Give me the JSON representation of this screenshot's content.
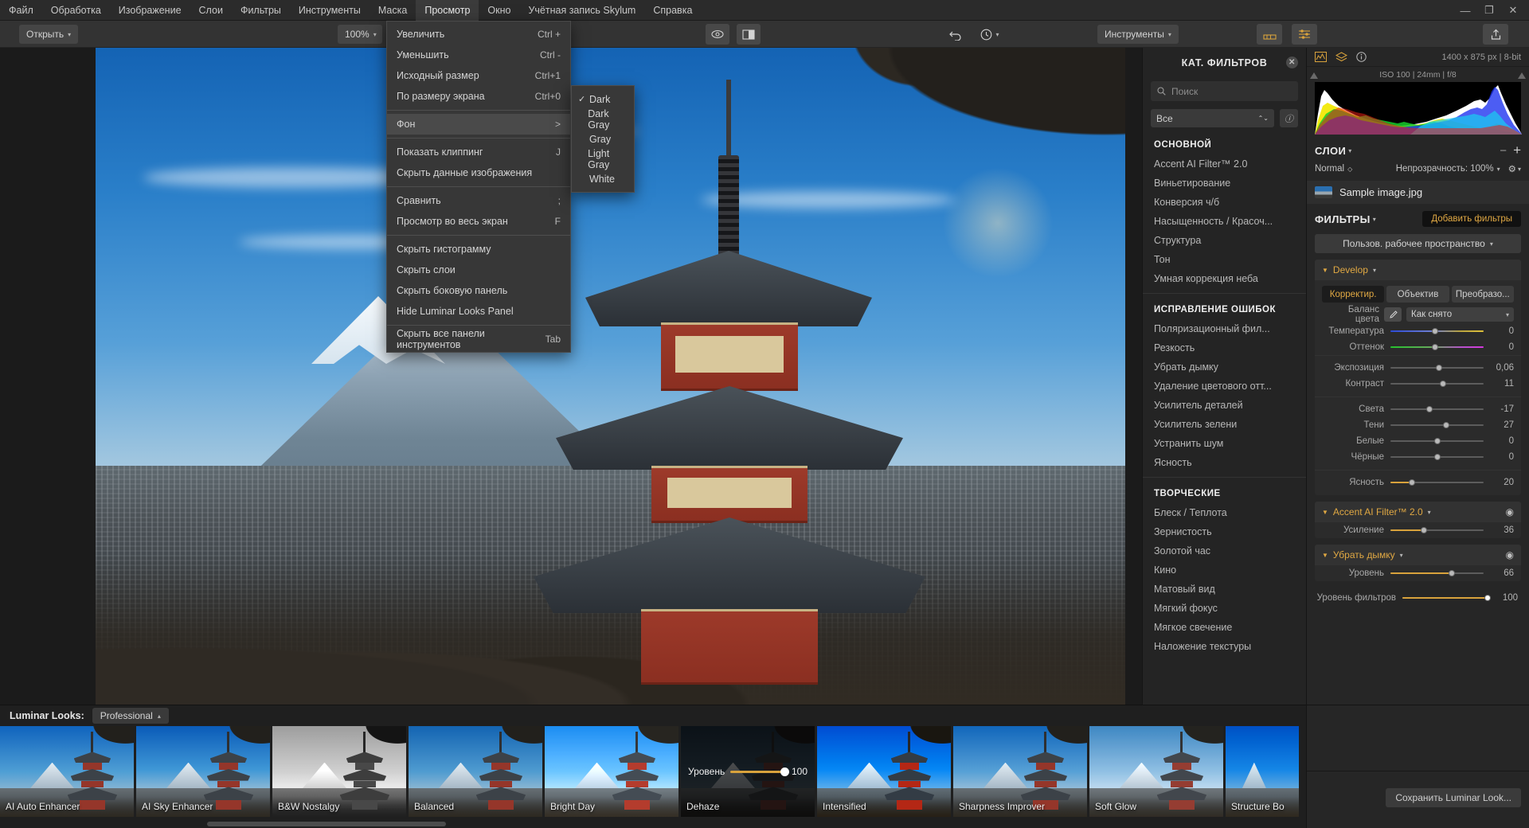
{
  "app": {
    "menubar": [
      {
        "label": "Файл",
        "active": false
      },
      {
        "label": "Обработка",
        "active": false
      },
      {
        "label": "Изображение",
        "active": false
      },
      {
        "label": "Слои",
        "active": false
      },
      {
        "label": "Фильтры",
        "active": false
      },
      {
        "label": "Инструменты",
        "active": false
      },
      {
        "label": "Маска",
        "active": false
      },
      {
        "label": "Просмотр",
        "active": true
      },
      {
        "label": "Окно",
        "active": false
      },
      {
        "label": "Учётная запись Skylum",
        "active": false
      },
      {
        "label": "Справка",
        "active": false
      }
    ],
    "window_controls": {
      "minimize": "—",
      "maximize": "❐",
      "close": "✕"
    }
  },
  "toolbar": {
    "open_label": "Открыть",
    "zoom_value": "100%",
    "tools_label": "Инструменты"
  },
  "view_menu": {
    "items": [
      {
        "label": "Увеличить",
        "shortcut": "Ctrl +",
        "sep_after": false,
        "highlight": false,
        "submenu": false
      },
      {
        "label": "Уменьшить",
        "shortcut": "Ctrl -",
        "sep_after": false,
        "highlight": false,
        "submenu": false
      },
      {
        "label": "Исходный размер",
        "shortcut": "Ctrl+1",
        "sep_after": false,
        "highlight": false,
        "submenu": false
      },
      {
        "label": "По размеру экрана",
        "shortcut": "Ctrl+0",
        "sep_after": true,
        "highlight": false,
        "submenu": false
      },
      {
        "label": "Фон",
        "shortcut": ">",
        "sep_after": true,
        "highlight": true,
        "submenu": true
      },
      {
        "label": "Показать клиппинг",
        "shortcut": "J",
        "sep_after": false,
        "highlight": false,
        "submenu": false
      },
      {
        "label": "Скрыть данные изображения",
        "shortcut": "",
        "sep_after": true,
        "highlight": false,
        "submenu": false
      },
      {
        "label": "Сравнить",
        "shortcut": ";",
        "sep_after": false,
        "highlight": false,
        "submenu": false
      },
      {
        "label": "Просмотр во весь экран",
        "shortcut": "F",
        "sep_after": true,
        "highlight": false,
        "submenu": false
      },
      {
        "label": "Скрыть гистограмму",
        "shortcut": "",
        "sep_after": false,
        "highlight": false,
        "submenu": false
      },
      {
        "label": "Скрыть слои",
        "shortcut": "",
        "sep_after": false,
        "highlight": false,
        "submenu": false
      },
      {
        "label": "Скрыть боковую панель",
        "shortcut": "",
        "sep_after": false,
        "highlight": false,
        "submenu": false
      },
      {
        "label": "Hide Luminar Looks Panel",
        "shortcut": "",
        "sep_after": true,
        "highlight": false,
        "submenu": false
      },
      {
        "label": "Скрыть все панели инструментов",
        "shortcut": "Tab",
        "sep_after": false,
        "highlight": false,
        "submenu": false
      }
    ],
    "submenu": {
      "title": "Фон",
      "items": [
        {
          "label": "Dark",
          "checked": true
        },
        {
          "label": "Dark Gray",
          "checked": false
        },
        {
          "label": "Gray",
          "checked": false
        },
        {
          "label": "Light Gray",
          "checked": false
        },
        {
          "label": "White",
          "checked": false
        }
      ]
    }
  },
  "catalog": {
    "title": "КАТ. ФИЛЬТРОВ",
    "search_placeholder": "Поиск",
    "filter_select": "Все",
    "groups": [
      {
        "name": "ОСНОВНОЙ",
        "items": [
          "Accent AI Filter™ 2.0",
          "Виньетирование",
          "Конверсия ч/б",
          "Насыщенность / Красоч...",
          "Структура",
          "Тон",
          "Умная коррекция неба"
        ]
      },
      {
        "name": "ИСПРАВЛЕНИЕ ОШИБОК",
        "items": [
          "Поляризационный фил...",
          "Резкость",
          "Убрать дымку",
          "Удаление цветового отт...",
          "Усилитель деталей",
          "Усилитель зелени",
          "Устранить шум",
          "Ясность"
        ]
      },
      {
        "name": "ТВОРЧЕСКИЕ",
        "items": [
          "Блеск / Теплота",
          "Зернистость",
          "Золотой час",
          "Кино",
          "Матовый вид",
          "Мягкий фокус",
          "Мягкое свечение",
          "Наложение текстуры"
        ]
      }
    ]
  },
  "right_panel": {
    "image_info": "1400 x 875 px  |  8-bit",
    "exif": "ISO 100  |  24mm  |  f/8",
    "layers_title": "СЛОИ",
    "blend_mode": "Normal",
    "opacity_label": "Непрозрачность: 100%",
    "layer_name": "Sample image.jpg",
    "filters_title": "ФИЛЬТРЫ",
    "add_filters_label": "Добавить фильтры",
    "workspace_label": "Пользов. рабочее пространство",
    "develop_label": "Develop",
    "tabs": [
      {
        "label": "Корректир.",
        "active": true
      },
      {
        "label": "Объектив",
        "active": false
      },
      {
        "label": "Преобразо...",
        "active": false
      }
    ],
    "white_balance": {
      "label": "Баланс цвета",
      "value": "Как снято"
    },
    "sliders": [
      {
        "label": "Температура",
        "value": "0",
        "pos": 48,
        "type": "temp"
      },
      {
        "label": "Оттенок",
        "value": "0",
        "pos": 48,
        "type": "tint"
      }
    ],
    "sliders2": [
      {
        "label": "Экспозиция",
        "value": "0,06",
        "pos": 52
      },
      {
        "label": "Контраст",
        "value": "11",
        "pos": 56
      }
    ],
    "sliders3": [
      {
        "label": "Света",
        "value": "-17",
        "pos": 42
      },
      {
        "label": "Тени",
        "value": "27",
        "pos": 60
      },
      {
        "label": "Белые",
        "value": "0",
        "pos": 50
      },
      {
        "label": "Чёрные",
        "value": "0",
        "pos": 50
      }
    ],
    "sliders4": [
      {
        "label": "Ясность",
        "value": "20",
        "pos": 23,
        "filled": true
      }
    ],
    "filter_groups": [
      {
        "name": "Accent AI Filter™ 2.0",
        "sliders": [
          {
            "label": "Усиление",
            "value": "36",
            "pos": 36,
            "filled": true
          }
        ]
      },
      {
        "name": "Убрать дымку",
        "sliders": [
          {
            "label": "Уровень",
            "value": "66",
            "pos": 66,
            "filled": true
          }
        ]
      }
    ],
    "filters_amount": {
      "label": "Уровень фильтров",
      "value": "100",
      "pos": 100
    }
  },
  "looks": {
    "title": "Luminar Looks:",
    "category": "Professional",
    "items": [
      {
        "name": "AI Auto Enhancer",
        "style": "normal",
        "selected": false
      },
      {
        "name": "AI Sky Enhancer",
        "style": "normal",
        "selected": false
      },
      {
        "name": "B&W Nostalgy",
        "style": "bw",
        "selected": false
      },
      {
        "name": "Balanced",
        "style": "normal",
        "selected": false
      },
      {
        "name": "Bright Day",
        "style": "bright",
        "selected": false
      },
      {
        "name": "Dehaze",
        "style": "dark",
        "selected": true,
        "slider": {
          "label": "Уровень",
          "value": "100"
        }
      },
      {
        "name": "Intensified",
        "style": "deep",
        "selected": false
      },
      {
        "name": "Sharpness Improver",
        "style": "normal",
        "selected": false
      },
      {
        "name": "Soft Glow",
        "style": "soft",
        "selected": false
      },
      {
        "name": "Structure Bo",
        "style": "deep",
        "selected": false
      }
    ],
    "save_look_label": "Сохранить Luminar Look..."
  },
  "colors": {
    "accent": "#e0a843",
    "panel_bg": "#262626",
    "catalog_bg": "#242424",
    "toolbar_bg": "#333333",
    "menubar_bg": "#2b2b2b"
  }
}
